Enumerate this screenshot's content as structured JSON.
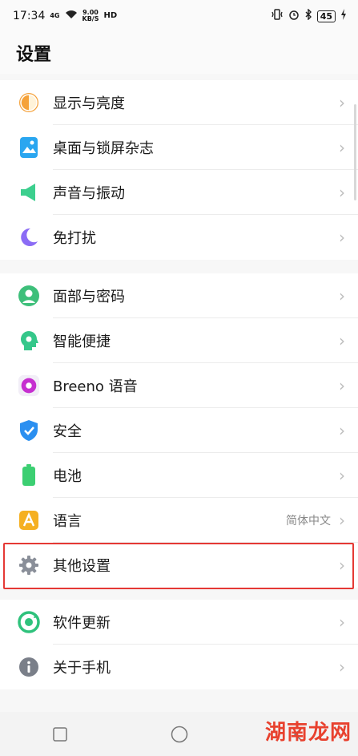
{
  "status_bar": {
    "time": "17:34",
    "network": "4G",
    "speed_value": "9.00",
    "speed_unit": "KB/S",
    "hd": "HD",
    "battery": "45"
  },
  "header": {
    "title": "设置"
  },
  "groups": [
    {
      "items": [
        {
          "label": "显示与亮度",
          "icon": "brightness-icon",
          "color": "#f5a23a"
        },
        {
          "label": "桌面与锁屏杂志",
          "icon": "wallpaper-icon",
          "color": "#2aa6f0"
        },
        {
          "label": "声音与振动",
          "icon": "speaker-icon",
          "color": "#3ccf8e"
        },
        {
          "label": "免打扰",
          "icon": "moon-icon",
          "color": "#8b6cf5"
        }
      ]
    },
    {
      "items": [
        {
          "label": "面部与密码",
          "icon": "face-icon",
          "color": "#3dbf7a"
        },
        {
          "label": "智能便捷",
          "icon": "smart-head-icon",
          "color": "#35c78a"
        },
        {
          "label": "Breeno 语音",
          "icon": "breeno-icon",
          "color": "#c62fd0"
        },
        {
          "label": "安全",
          "icon": "shield-icon",
          "color": "#2b8ff0"
        },
        {
          "label": "电池",
          "icon": "battery-icon",
          "color": "#3ccf72"
        },
        {
          "label": "语言",
          "icon": "language-icon",
          "color": "#f5b021",
          "value": "简体中文"
        },
        {
          "label": "其他设置",
          "icon": "gear-icon",
          "color": "#8a8f99"
        }
      ]
    },
    {
      "items": [
        {
          "label": "软件更新",
          "icon": "update-icon",
          "color": "#2fc27c"
        },
        {
          "label": "关于手机",
          "icon": "info-icon",
          "color": "#7a7f89"
        }
      ]
    }
  ],
  "watermark": "湖南龙网"
}
